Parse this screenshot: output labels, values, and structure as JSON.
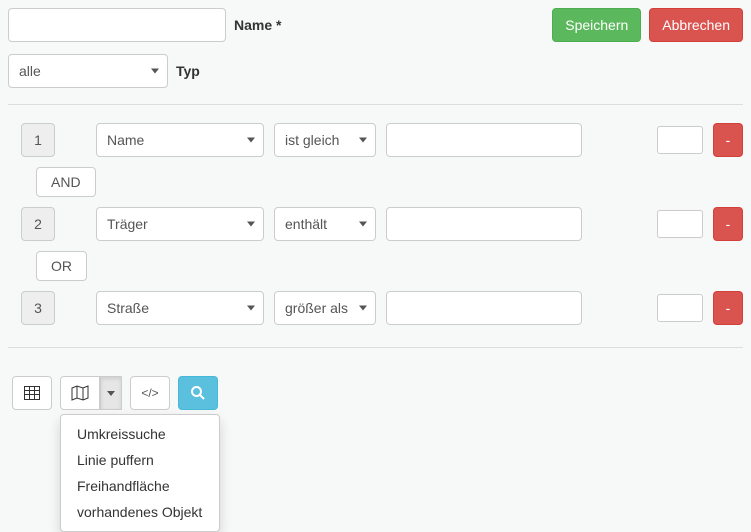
{
  "header": {
    "name_label": "Name *",
    "type_label": "Typ",
    "type_selected": "alle",
    "save": "Speichern",
    "cancel": "Abbrechen"
  },
  "rules": [
    {
      "n": "1",
      "field": "Name",
      "op": "ist gleich",
      "value": "",
      "bool": "AND"
    },
    {
      "n": "2",
      "field": "Träger",
      "op": "enthält",
      "value": "",
      "bool": "OR"
    },
    {
      "n": "3",
      "field": "Straße",
      "op": "größer als",
      "value": ""
    }
  ],
  "toolbar": {
    "remove_glyph": "-",
    "code_glyph": "</>"
  },
  "dropdown": {
    "items": [
      "Umkreissuche",
      "Linie puffern",
      "Freihandfläche",
      "vorhandenes Objekt"
    ]
  }
}
